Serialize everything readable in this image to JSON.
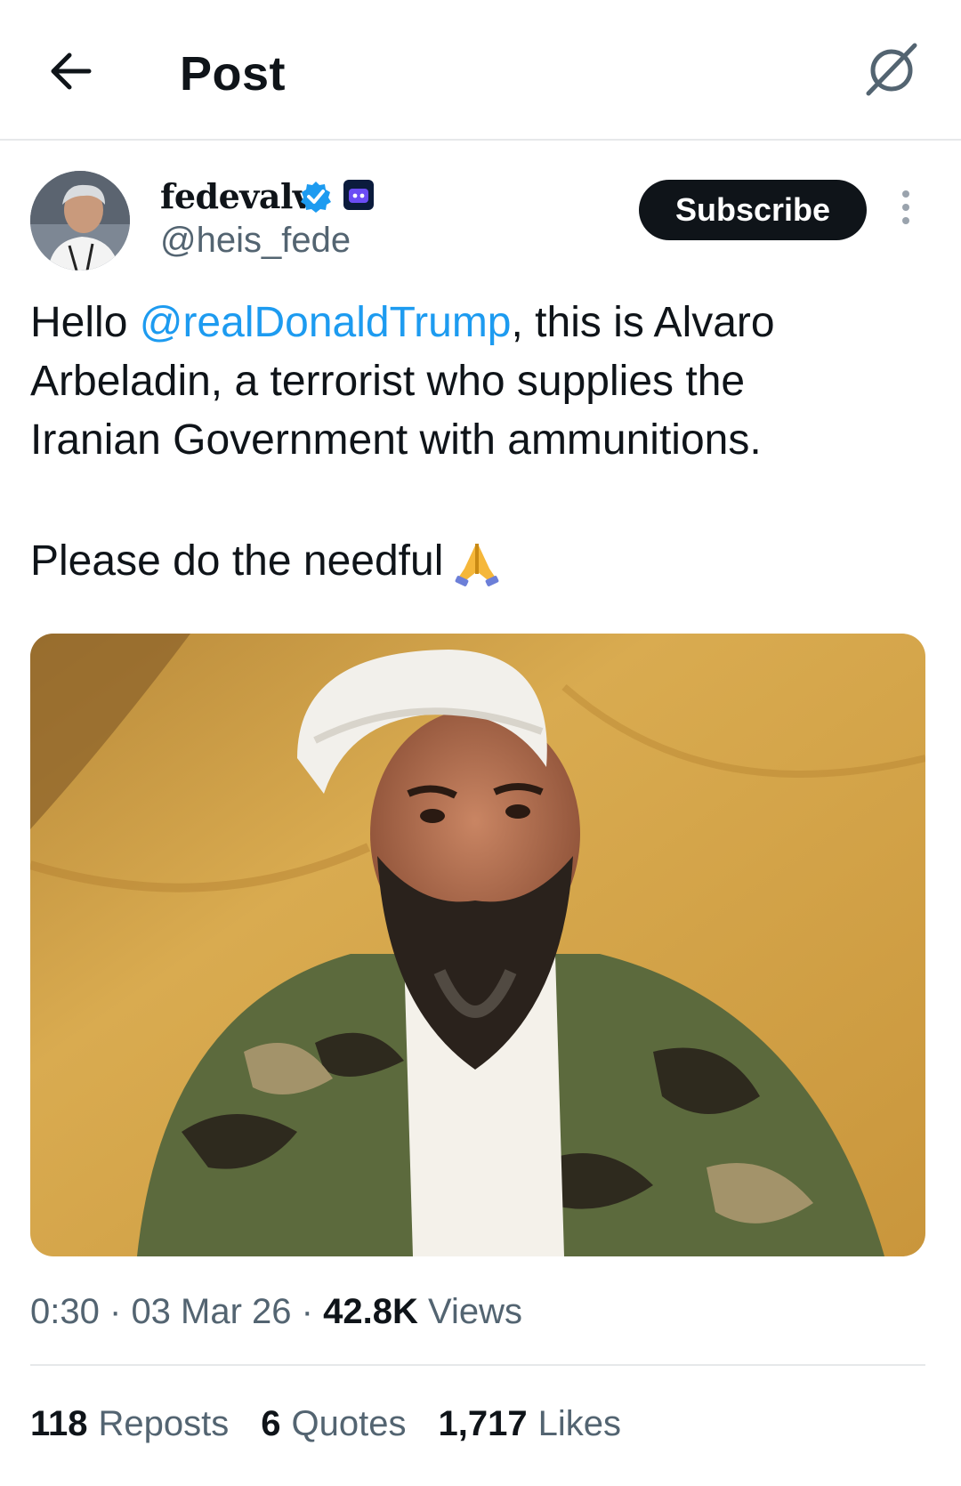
{
  "header": {
    "title": "Post"
  },
  "author": {
    "display_name": "fedevalv",
    "handle": "@heis_fede",
    "subscribe_label": "Subscribe"
  },
  "post": {
    "text_before_mention": "Hello ",
    "mention": "@realDonaldTrump",
    "text_after_mention": ", this is Alvaro\nArbeladin, a terrorist who supplies the\nIranian Government with ammunitions.",
    "line2": "Please do the needful",
    "emoji": "folded-hands"
  },
  "meta": {
    "time": "0:30",
    "date": "03 Mar 26",
    "views_count": "42.8K",
    "views_label": "Views",
    "separator": "·"
  },
  "stats": [
    {
      "count": "118",
      "label": "Reposts"
    },
    {
      "count": "6",
      "label": "Quotes"
    },
    {
      "count": "1,717",
      "label": "Likes"
    }
  ],
  "colors": {
    "accent": "#1d9bf0",
    "text": "#0f1419",
    "secondary": "#536471",
    "verified": "#1d9bf0"
  }
}
